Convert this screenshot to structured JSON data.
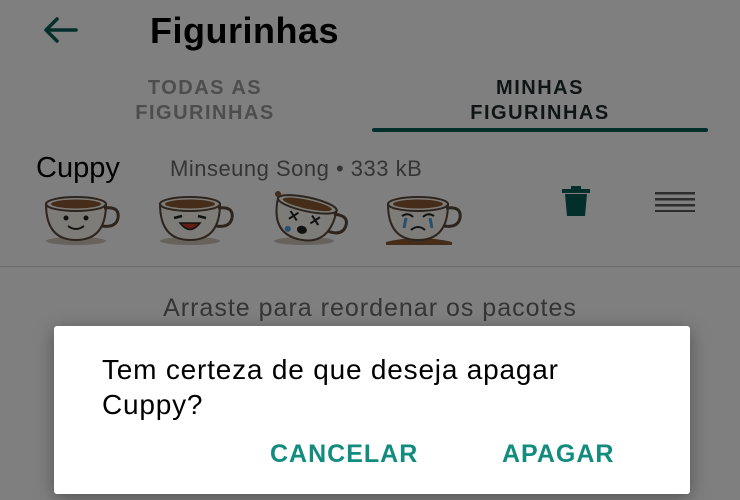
{
  "appbar": {
    "title": "Figurinhas",
    "back_icon": "arrow-back-icon"
  },
  "tabs": [
    {
      "label": "TODAS AS FIGURINHAS",
      "line1": "TODAS AS",
      "line2": "FIGURINHAS",
      "selected": false
    },
    {
      "label": "MINHAS FIGURINHAS",
      "line1": "MINHAS",
      "line2": "FIGURINHAS",
      "selected": true
    }
  ],
  "pack": {
    "name": "Cuppy",
    "meta": "Minseung Song • 333 kB",
    "stickers": [
      "cup-smile",
      "cup-laugh",
      "cup-dizzy",
      "cup-cry"
    ],
    "delete_icon": "trash-icon",
    "drag_icon": "drag-handle-icon"
  },
  "hint": "Arraste para reordenar os pacotes",
  "dialog": {
    "message": "Tem certeza de que deseja apagar Cuppy?",
    "cancel_label": "CANCELAR",
    "confirm_label": "APAGAR"
  },
  "colors": {
    "accent": "#128c7e",
    "indicator": "#075e54",
    "scrim": "rgba(0,0,0,0.5)"
  }
}
